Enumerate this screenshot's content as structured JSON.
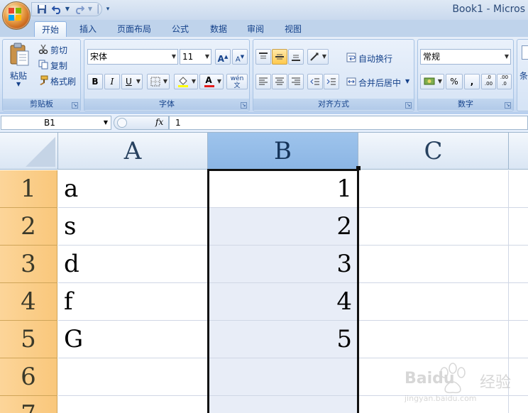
{
  "window": {
    "title": "Book1 - Micros"
  },
  "quick_access": {
    "items": [
      "save-icon",
      "undo-icon",
      "redo-icon",
      "customize-icon"
    ],
    "separator": "|"
  },
  "tabs": [
    {
      "label": "开始",
      "active": true
    },
    {
      "label": "插入"
    },
    {
      "label": "页面布局"
    },
    {
      "label": "公式"
    },
    {
      "label": "数据"
    },
    {
      "label": "审阅"
    },
    {
      "label": "视图"
    }
  ],
  "ribbon": {
    "clipboard": {
      "label": "剪贴板",
      "paste": "粘贴",
      "cut": "剪切",
      "copy": "复制",
      "format_painter": "格式刷"
    },
    "font": {
      "label": "字体",
      "font_name": "宋体",
      "font_size": "11",
      "bold": "B",
      "italic": "I",
      "underline": "U",
      "grow": "A",
      "shrink": "A",
      "phonetic": "wén",
      "font_color_letter": "A"
    },
    "alignment": {
      "label": "对齐方式",
      "wrap_text": "自动换行",
      "merge_center": "合并后居中"
    },
    "number": {
      "label": "数字",
      "format": "常规",
      "percent": "%",
      "comma": ",",
      "inc_decimal": ".0 .00",
      "dec_decimal": ".00 .0"
    },
    "more": {
      "label": "条"
    }
  },
  "formula_bar": {
    "name_box": "B1",
    "fx": "fx",
    "value": "1"
  },
  "sheet": {
    "columns": [
      "A",
      "B",
      "C"
    ],
    "rows": [
      "1",
      "2",
      "3",
      "4",
      "5",
      "6",
      "7"
    ],
    "selected_column": "B",
    "active_cell": "B1",
    "cells": {
      "A": [
        "a",
        "s",
        "d",
        "f",
        "G",
        "",
        ""
      ],
      "B": [
        "1",
        "2",
        "3",
        "4",
        "5",
        "",
        ""
      ],
      "C": [
        "",
        "",
        "",
        "",
        "",
        "",
        ""
      ]
    }
  },
  "watermark": {
    "brand": "Baidu",
    "text": "经验",
    "url": "jingyan.baidu.com"
  },
  "colors": {
    "selected_header": "#9ec4ec",
    "row_header": "#fcd599",
    "ribbon": "#d9e6f7"
  }
}
